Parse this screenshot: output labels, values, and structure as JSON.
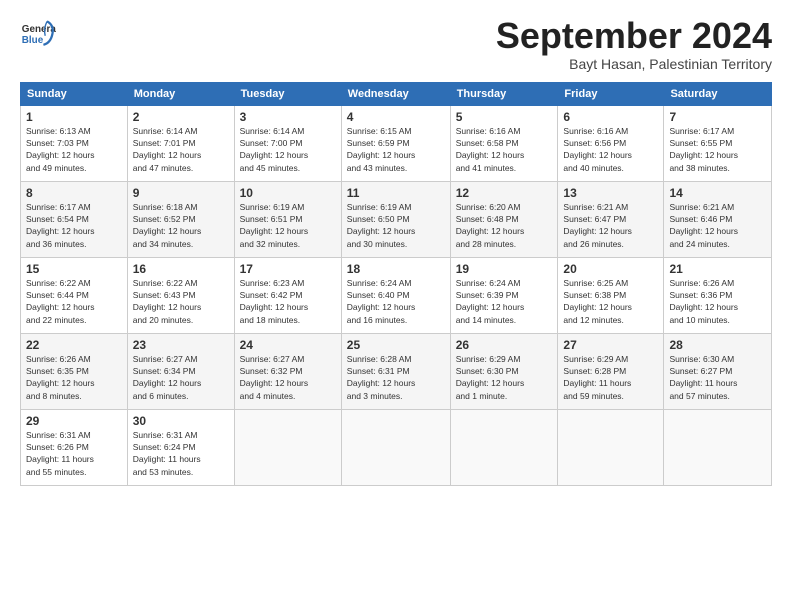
{
  "header": {
    "logo_line1": "General",
    "logo_line2": "Blue",
    "month_title": "September 2024",
    "subtitle": "Bayt Hasan, Palestinian Territory"
  },
  "days_of_week": [
    "Sunday",
    "Monday",
    "Tuesday",
    "Wednesday",
    "Thursday",
    "Friday",
    "Saturday"
  ],
  "weeks": [
    [
      {
        "day": "1",
        "info": "Sunrise: 6:13 AM\nSunset: 7:03 PM\nDaylight: 12 hours\nand 49 minutes."
      },
      {
        "day": "2",
        "info": "Sunrise: 6:14 AM\nSunset: 7:01 PM\nDaylight: 12 hours\nand 47 minutes."
      },
      {
        "day": "3",
        "info": "Sunrise: 6:14 AM\nSunset: 7:00 PM\nDaylight: 12 hours\nand 45 minutes."
      },
      {
        "day": "4",
        "info": "Sunrise: 6:15 AM\nSunset: 6:59 PM\nDaylight: 12 hours\nand 43 minutes."
      },
      {
        "day": "5",
        "info": "Sunrise: 6:16 AM\nSunset: 6:58 PM\nDaylight: 12 hours\nand 41 minutes."
      },
      {
        "day": "6",
        "info": "Sunrise: 6:16 AM\nSunset: 6:56 PM\nDaylight: 12 hours\nand 40 minutes."
      },
      {
        "day": "7",
        "info": "Sunrise: 6:17 AM\nSunset: 6:55 PM\nDaylight: 12 hours\nand 38 minutes."
      }
    ],
    [
      {
        "day": "8",
        "info": "Sunrise: 6:17 AM\nSunset: 6:54 PM\nDaylight: 12 hours\nand 36 minutes."
      },
      {
        "day": "9",
        "info": "Sunrise: 6:18 AM\nSunset: 6:52 PM\nDaylight: 12 hours\nand 34 minutes."
      },
      {
        "day": "10",
        "info": "Sunrise: 6:19 AM\nSunset: 6:51 PM\nDaylight: 12 hours\nand 32 minutes."
      },
      {
        "day": "11",
        "info": "Sunrise: 6:19 AM\nSunset: 6:50 PM\nDaylight: 12 hours\nand 30 minutes."
      },
      {
        "day": "12",
        "info": "Sunrise: 6:20 AM\nSunset: 6:48 PM\nDaylight: 12 hours\nand 28 minutes."
      },
      {
        "day": "13",
        "info": "Sunrise: 6:21 AM\nSunset: 6:47 PM\nDaylight: 12 hours\nand 26 minutes."
      },
      {
        "day": "14",
        "info": "Sunrise: 6:21 AM\nSunset: 6:46 PM\nDaylight: 12 hours\nand 24 minutes."
      }
    ],
    [
      {
        "day": "15",
        "info": "Sunrise: 6:22 AM\nSunset: 6:44 PM\nDaylight: 12 hours\nand 22 minutes."
      },
      {
        "day": "16",
        "info": "Sunrise: 6:22 AM\nSunset: 6:43 PM\nDaylight: 12 hours\nand 20 minutes."
      },
      {
        "day": "17",
        "info": "Sunrise: 6:23 AM\nSunset: 6:42 PM\nDaylight: 12 hours\nand 18 minutes."
      },
      {
        "day": "18",
        "info": "Sunrise: 6:24 AM\nSunset: 6:40 PM\nDaylight: 12 hours\nand 16 minutes."
      },
      {
        "day": "19",
        "info": "Sunrise: 6:24 AM\nSunset: 6:39 PM\nDaylight: 12 hours\nand 14 minutes."
      },
      {
        "day": "20",
        "info": "Sunrise: 6:25 AM\nSunset: 6:38 PM\nDaylight: 12 hours\nand 12 minutes."
      },
      {
        "day": "21",
        "info": "Sunrise: 6:26 AM\nSunset: 6:36 PM\nDaylight: 12 hours\nand 10 minutes."
      }
    ],
    [
      {
        "day": "22",
        "info": "Sunrise: 6:26 AM\nSunset: 6:35 PM\nDaylight: 12 hours\nand 8 minutes."
      },
      {
        "day": "23",
        "info": "Sunrise: 6:27 AM\nSunset: 6:34 PM\nDaylight: 12 hours\nand 6 minutes."
      },
      {
        "day": "24",
        "info": "Sunrise: 6:27 AM\nSunset: 6:32 PM\nDaylight: 12 hours\nand 4 minutes."
      },
      {
        "day": "25",
        "info": "Sunrise: 6:28 AM\nSunset: 6:31 PM\nDaylight: 12 hours\nand 3 minutes."
      },
      {
        "day": "26",
        "info": "Sunrise: 6:29 AM\nSunset: 6:30 PM\nDaylight: 12 hours\nand 1 minute."
      },
      {
        "day": "27",
        "info": "Sunrise: 6:29 AM\nSunset: 6:28 PM\nDaylight: 11 hours\nand 59 minutes."
      },
      {
        "day": "28",
        "info": "Sunrise: 6:30 AM\nSunset: 6:27 PM\nDaylight: 11 hours\nand 57 minutes."
      }
    ],
    [
      {
        "day": "29",
        "info": "Sunrise: 6:31 AM\nSunset: 6:26 PM\nDaylight: 11 hours\nand 55 minutes."
      },
      {
        "day": "30",
        "info": "Sunrise: 6:31 AM\nSunset: 6:24 PM\nDaylight: 11 hours\nand 53 minutes."
      },
      {
        "day": "",
        "info": ""
      },
      {
        "day": "",
        "info": ""
      },
      {
        "day": "",
        "info": ""
      },
      {
        "day": "",
        "info": ""
      },
      {
        "day": "",
        "info": ""
      }
    ]
  ]
}
